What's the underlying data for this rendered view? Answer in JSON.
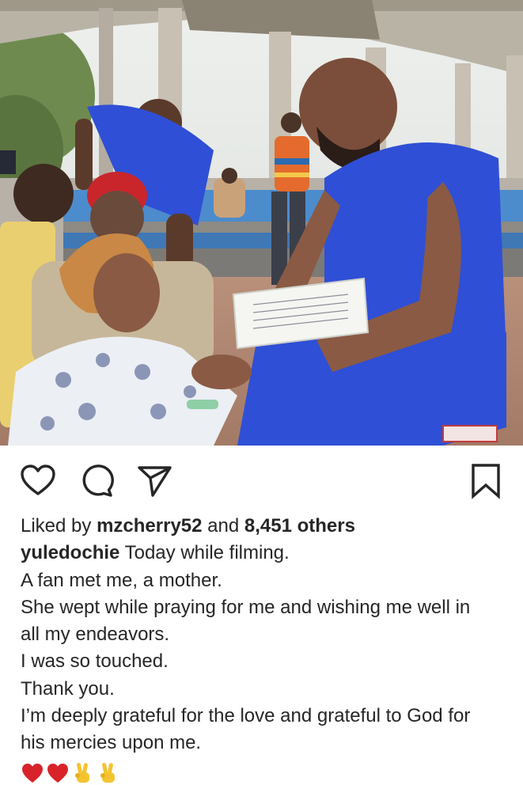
{
  "post": {
    "liked_by_prefix": "Liked by",
    "liked_by_user": "mzcherry52",
    "liked_by_and": "and",
    "liked_by_others": "8,451 others",
    "author": "yuledochie",
    "caption_first": "Today while filming.",
    "caption_lines": [
      "A fan met me, a mother.",
      "She wept while praying for me and wishing me well in",
      "all my endeavors.",
      "I was so touched.",
      "Thank you.",
      "I’m deeply grateful for the love and grateful to God for",
      "his mercies upon me."
    ],
    "emojis": [
      "red-heart",
      "red-heart",
      "victory-hand",
      "victory-hand"
    ]
  },
  "photo": {
    "description_icon": "post-photo",
    "palette": {
      "shirt_blue": "#2f4fd6",
      "sky": "#e9ece9",
      "roof": "#b9b3a6"
    }
  },
  "actions": {
    "like_icon": "heart-outline-icon",
    "comment_icon": "comment-bubble-icon",
    "share_icon": "paper-plane-icon",
    "save_icon": "bookmark-icon"
  }
}
